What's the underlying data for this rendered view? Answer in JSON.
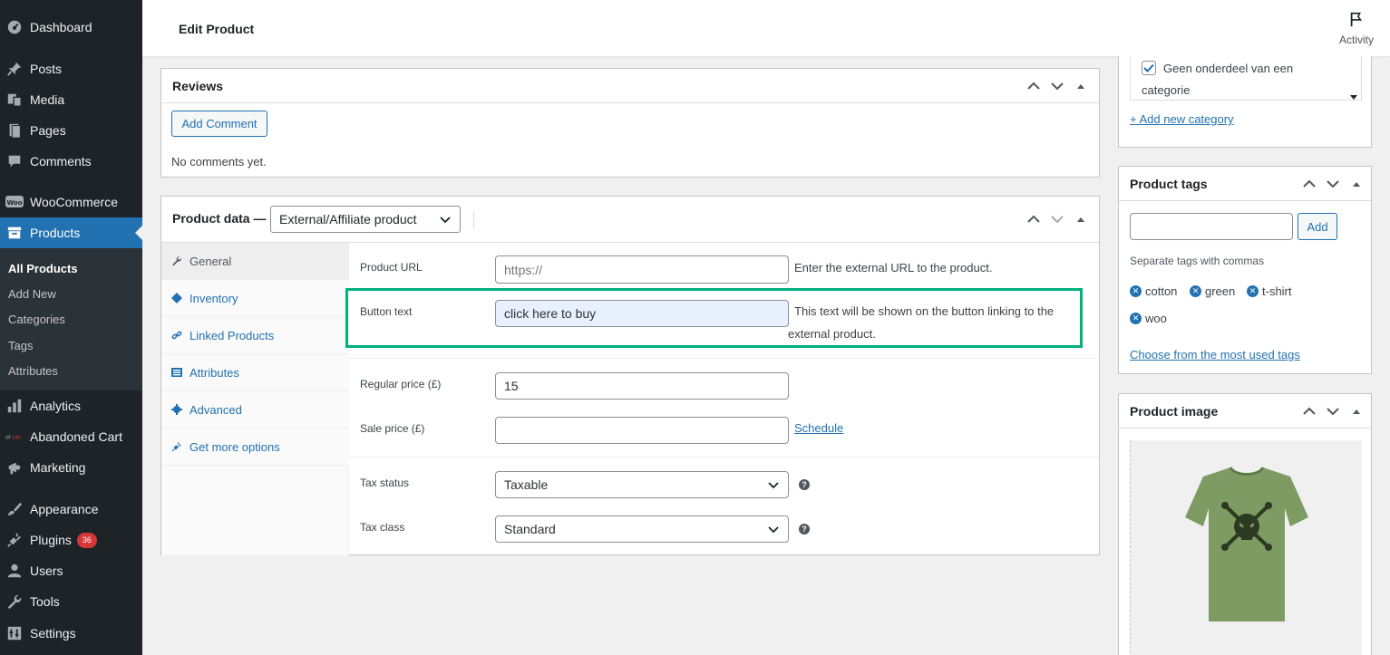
{
  "sidebar": {
    "items": [
      {
        "label": "Dashboard",
        "icon": "dashboard-icon"
      },
      {
        "label": "Posts",
        "icon": "pin-icon"
      },
      {
        "label": "Media",
        "icon": "media-icon"
      },
      {
        "label": "Pages",
        "icon": "pages-icon"
      },
      {
        "label": "Comments",
        "icon": "comment-icon"
      },
      {
        "label": "WooCommerce",
        "icon": "woo-icon"
      },
      {
        "label": "Products",
        "icon": "archive-icon"
      },
      {
        "label": "Analytics",
        "icon": "bar-chart-icon"
      },
      {
        "label": "Abandoned Cart",
        "icon": "cart-logo-icon"
      },
      {
        "label": "Marketing",
        "icon": "megaphone-icon"
      },
      {
        "label": "Appearance",
        "icon": "brush-icon"
      },
      {
        "label": "Plugins",
        "icon": "plug-icon",
        "badge": "36"
      },
      {
        "label": "Users",
        "icon": "user-icon"
      },
      {
        "label": "Tools",
        "icon": "wrench-icon"
      },
      {
        "label": "Settings",
        "icon": "settings-icon"
      }
    ],
    "products_submenu": [
      "All Products",
      "Add New",
      "Categories",
      "Tags",
      "Attributes"
    ]
  },
  "header": {
    "title": "Edit Product",
    "activity_label": "Activity"
  },
  "reviews": {
    "title": "Reviews",
    "add_comment": "Add Comment",
    "empty_text": "No comments yet."
  },
  "product_data": {
    "title": "Product data —",
    "type_value": "External/Affiliate product",
    "tabs": [
      "General",
      "Inventory",
      "Linked Products",
      "Attributes",
      "Advanced",
      "Get more options"
    ],
    "product_url": {
      "label": "Product URL",
      "placeholder": "https://",
      "value": "",
      "desc": "Enter the external URL to the product."
    },
    "button_text": {
      "label": "Button text",
      "value": "click here to buy",
      "desc_line1": "This text will be shown on the button linking to the",
      "desc_line2": "external product."
    },
    "regular_price": {
      "label": "Regular price (£)",
      "value": "15"
    },
    "sale_price": {
      "label": "Sale price (£)",
      "value": "",
      "schedule": "Schedule"
    },
    "tax_status": {
      "label": "Tax status",
      "value": "Taxable"
    },
    "tax_class": {
      "label": "Tax class",
      "value": "Standard"
    }
  },
  "categories": {
    "option_line1": "Geen onderdeel van een",
    "option_line2": "categorie",
    "checked": true,
    "add_new": "+ Add new category"
  },
  "product_tags": {
    "title": "Product tags",
    "add_button": "Add",
    "hint": "Separate tags with commas",
    "tags": [
      "cotton",
      "green",
      "t-shirt",
      "woo"
    ],
    "choose_link": "Choose from the most used tags"
  },
  "product_image": {
    "title": "Product image",
    "shirt_color": "#7d9b62"
  },
  "colors": {
    "highlight": "#00b07f",
    "accent": "#2271b1",
    "sidebar": "#1d2327"
  }
}
